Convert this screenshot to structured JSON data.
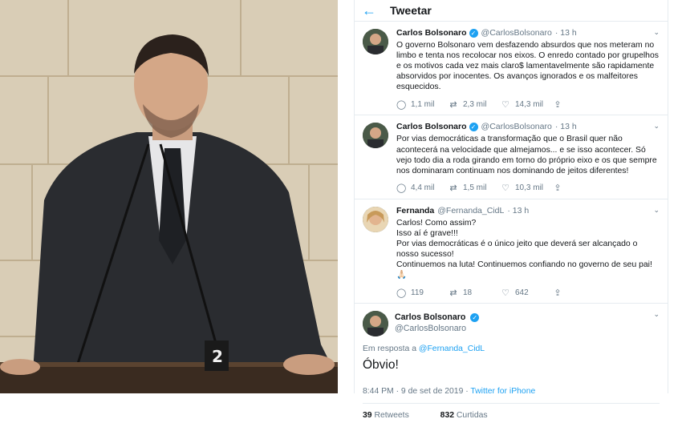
{
  "header": {
    "back_icon": "arrow-left-icon",
    "title": "Tweetar"
  },
  "tweets": [
    {
      "name": "Carlos Bolsonaro",
      "handle": "@CarlosBolsonaro",
      "time": "· 13 h",
      "verified": true,
      "text": "O governo Bolsonaro vem desfazendo absurdos que nos meteram no limbo e tenta nos recolocar nos eixos. O enredo contado por grupelhos e os motivos cada vez mais claro$ lamentavelmente são rapidamente absorvidos por inocentes. Os avanços ignorados e os malfeitores esquecidos.",
      "replies": "1,1 mil",
      "retweets": "2,3 mil",
      "likes": "14,3 mil"
    },
    {
      "name": "Carlos Bolsonaro",
      "handle": "@CarlosBolsonaro",
      "time": "· 13 h",
      "verified": true,
      "text": "Por vias democráticas a transformação que o Brasil quer não acontecerá na velocidade que almejamos... e se isso acontecer. Só vejo todo dia a roda girando em torno do próprio eixo e os que sempre nos dominaram continuam nos dominando de jeitos diferentes!",
      "replies": "4,4 mil",
      "retweets": "1,5 mil",
      "likes": "10,3 mil"
    },
    {
      "name": "Fernanda",
      "handle": "@Fernanda_CidL",
      "time": "· 13 h",
      "verified": false,
      "lines": [
        "Carlos! Como assim?",
        "Isso aí é grave!!!",
        "Por vias democráticas é o único jeito que deverá ser alcançado o nosso sucesso!",
        "Continuemos na luta! Continuemos confiando no governo de seu pai! 🙏🏻"
      ],
      "replies": "119",
      "retweets": "18",
      "likes": "642"
    }
  ],
  "main_tweet": {
    "name": "Carlos Bolsonaro",
    "handle": "@CarlosBolsonaro",
    "reply_prefix": "Em resposta a ",
    "reply_to": "@Fernanda_CidL",
    "text": "Óbvio!",
    "datetime": "8:44 PM · 9 de set de 2019 · ",
    "source": "Twitter for iPhone",
    "retweets_count": "39",
    "retweets_label": "Retweets",
    "likes_count": "832",
    "likes_label": "Curtidas"
  },
  "colors": {
    "accent": "#1da1f2",
    "muted": "#657786",
    "text": "#14171a",
    "border": "#e6ecf0"
  }
}
